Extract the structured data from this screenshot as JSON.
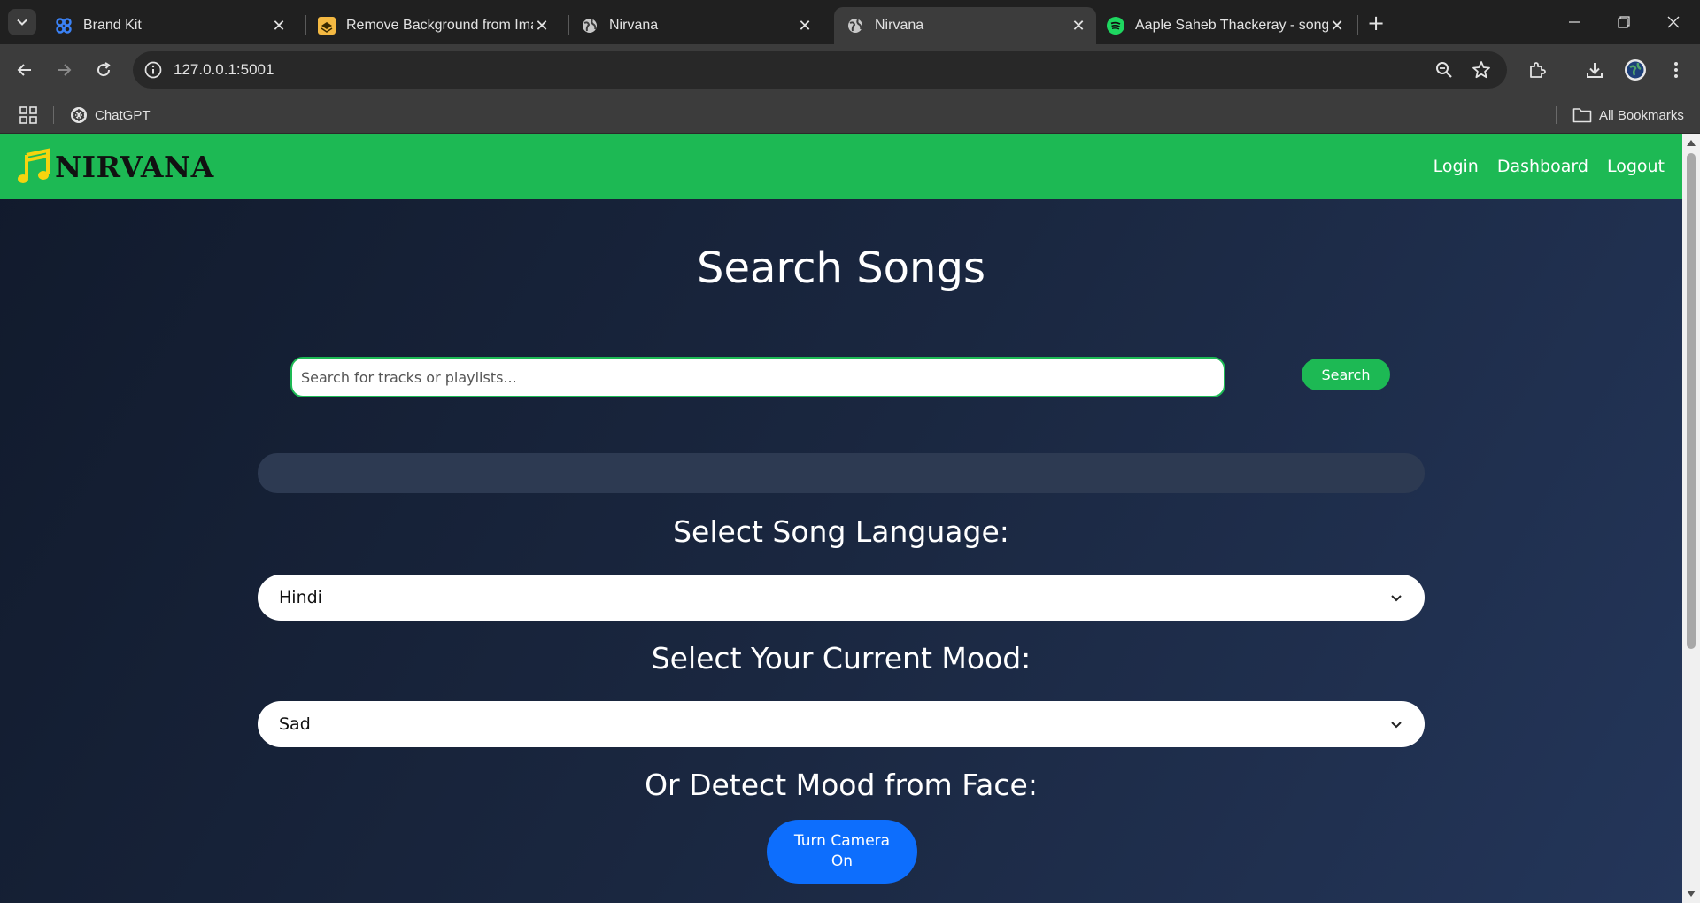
{
  "browser": {
    "tabs": [
      {
        "title": "Brand Kit",
        "icon": "brandkit-favicon",
        "active": false
      },
      {
        "title": "Remove Background from Imag",
        "icon": "removebg-favicon",
        "active": false
      },
      {
        "title": "Nirvana",
        "icon": "globe-icon",
        "active": false
      },
      {
        "title": "Nirvana",
        "icon": "globe-icon",
        "active": true
      },
      {
        "title": "Aaple Saheb Thackeray - song",
        "icon": "spotify-icon",
        "active": false
      }
    ],
    "url": "127.0.0.1:5001",
    "bookmarks": [
      {
        "label": "ChatGPT",
        "icon": "chatgpt-icon"
      }
    ],
    "all_bookmarks_label": "All Bookmarks"
  },
  "page": {
    "brand": "NIRVANA",
    "nav": {
      "login": "Login",
      "dashboard": "Dashboard",
      "logout": "Logout"
    },
    "title": "Search Songs",
    "search": {
      "placeholder": "Search for tracks or playlists...",
      "value": "",
      "button": "Search"
    },
    "language": {
      "heading": "Select Song Language:",
      "selected": "Hindi"
    },
    "mood": {
      "heading": "Select Your Current Mood:",
      "selected": "Sad"
    },
    "face": {
      "heading": "Or Detect Mood from Face:",
      "button": "Turn Camera On"
    }
  },
  "colors": {
    "brand_green": "#1db954",
    "camera_blue": "#0d6efd",
    "logo_yellow": "#f5d40f"
  }
}
